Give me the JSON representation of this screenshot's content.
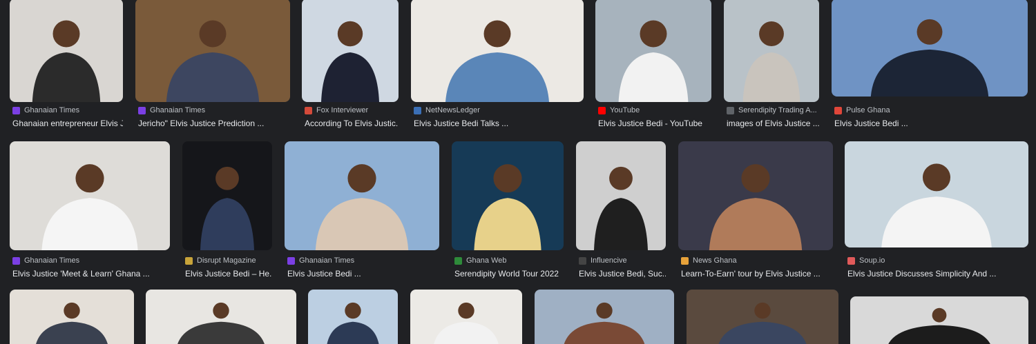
{
  "results": [
    {
      "source": "Ghanaian Times",
      "title": "Ghanaian entrepreneur Elvis J...",
      "favicon": "ghanaian-times-icon",
      "fav_color": "#7b3fe4",
      "bg": "#d9d6d2",
      "accent": "#2b2b2b"
    },
    {
      "source": "Ghanaian Times",
      "title": "Jericho\" Elvis Justice Prediction ...",
      "favicon": "ghanaian-times-icon",
      "fav_color": "#7b3fe4",
      "bg": "#7a5a3a",
      "accent": "#3d4660"
    },
    {
      "source": "Fox Interviewer",
      "title": "According To Elvis Justic...",
      "favicon": "fox-icon",
      "fav_color": "#d44a3a",
      "bg": "#cfd8e2",
      "accent": "#1e2233"
    },
    {
      "source": "NetNewsLedger",
      "title": "Elvis Justice Bedi Talks ...",
      "favicon": "netnewsledger-icon",
      "fav_color": "#3b6fb6",
      "bg": "#ece9e4",
      "accent": "#5a86b8"
    },
    {
      "source": "YouTube",
      "title": "Elvis Justice Bedi - YouTube",
      "favicon": "youtube-icon",
      "fav_color": "#ff0000",
      "bg": "#a7b3bd",
      "accent": "#f2f2f2"
    },
    {
      "source": "Serendipity Trading A...",
      "title": "images of Elvis Justice ...",
      "favicon": "serendipity-icon",
      "fav_color": "#5f6368",
      "bg": "#b9c2c8",
      "accent": "#c9c4bd"
    },
    {
      "source": "Pulse Ghana",
      "title": "Elvis Justice Bedi ...",
      "favicon": "pulse-ghana-icon",
      "fav_color": "#e0463a",
      "bg": "#6f93c4",
      "accent": "#1c2536"
    },
    {
      "source": "Ghanaian Times",
      "title": "Elvis Justice 'Meet & Learn' Ghana ...",
      "favicon": "ghanaian-times-icon",
      "fav_color": "#7b3fe4",
      "bg": "#dedcd8",
      "accent": "#f5f5f5"
    },
    {
      "source": "Disrupt Magazine",
      "title": "Elvis Justice Bedi – He...",
      "favicon": "disrupt-icon",
      "fav_color": "#c8a43a",
      "bg": "#15161a",
      "accent": "#2f3d5c"
    },
    {
      "source": "Ghanaian Times",
      "title": "Elvis Justice Bedi ...",
      "favicon": "ghanaian-times-icon",
      "fav_color": "#7b3fe4",
      "bg": "#8fb0d4",
      "accent": "#d9c7b5"
    },
    {
      "source": "Ghana Web",
      "title": "Serendipity World Tour 2022",
      "favicon": "ghanaweb-icon",
      "fav_color": "#2e8b3a",
      "bg": "#163a56",
      "accent": "#e7d18a"
    },
    {
      "source": "Influencive",
      "title": "Elvis Justice Bedi, Suc...",
      "favicon": "influencive-icon",
      "fav_color": "#444444",
      "bg": "#cfcfcf",
      "accent": "#1f1f1f"
    },
    {
      "source": "News Ghana",
      "title": "Learn-To-Earn' tour by Elvis Justice ...",
      "favicon": "news-ghana-icon",
      "fav_color": "#e7a23a",
      "bg": "#3a3a4a",
      "accent": "#b07b5a"
    },
    {
      "source": "Soup.io",
      "title": "Elvis Justice Discusses Simplicity And ...",
      "favicon": "soup-icon",
      "fav_color": "#e05a5a",
      "bg": "#c9d6de",
      "accent": "#f4f4f4"
    },
    {
      "source": "",
      "title": "",
      "favicon": "",
      "fav_color": "#5f6368",
      "bg": "#e4dfd8",
      "accent": "#3a4150"
    },
    {
      "source": "",
      "title": "",
      "favicon": "",
      "fav_color": "#5f6368",
      "bg": "#e8e6e2",
      "accent": "#3a3a3a"
    },
    {
      "source": "",
      "title": "",
      "favicon": "",
      "fav_color": "#5f6368",
      "bg": "#bccfe2",
      "accent": "#2c3a55"
    },
    {
      "source": "",
      "title": "",
      "favicon": "",
      "fav_color": "#5f6368",
      "bg": "#eceae6",
      "accent": "#f2f2f2"
    },
    {
      "source": "",
      "title": "",
      "favicon": "",
      "fav_color": "#5f6368",
      "bg": "#9fb0c4",
      "accent": "#7a4a36"
    },
    {
      "source": "",
      "title": "",
      "favicon": "",
      "fav_color": "#5f6368",
      "bg": "#5a4a3e",
      "accent": "#3a4660"
    },
    {
      "source": "",
      "title": "",
      "favicon": "",
      "fav_color": "#5f6368",
      "bg": "#d9d9d9",
      "accent": "#1c1c1c"
    }
  ]
}
